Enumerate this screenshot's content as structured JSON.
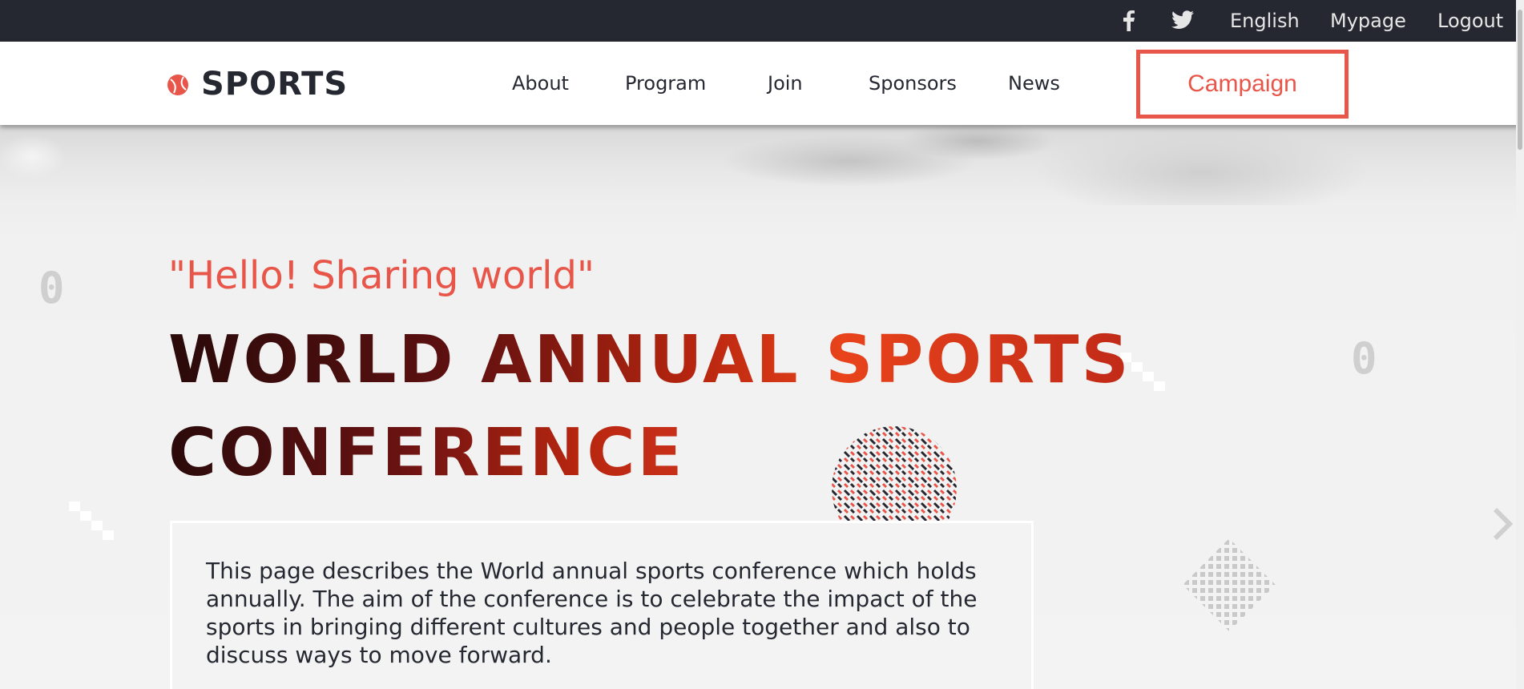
{
  "topbar": {
    "icons": [
      "facebook-icon",
      "twitter-icon"
    ],
    "language": "English",
    "mypage": "Mypage",
    "logout": "Logout"
  },
  "nav": {
    "logo_text": "SPORTS",
    "links": [
      "About",
      "Program",
      "Join",
      "Sponsors",
      "News"
    ],
    "campaign": "Campaign"
  },
  "hero": {
    "tagline": "\"Hello! Sharing world\"",
    "title_line1": "WORLD ANNUAL SPORTS",
    "title_line2": "CONFERENCE",
    "description": "This page describes the World annual sports conference which holds annually. The aim of the conference is to celebrate the impact of the sports in bringing different cultures and people together and also to discuss ways to move forward.",
    "deco_digit": "0"
  },
  "colors": {
    "accent": "#e8564a",
    "dark": "#252831",
    "white": "#ffffff"
  }
}
